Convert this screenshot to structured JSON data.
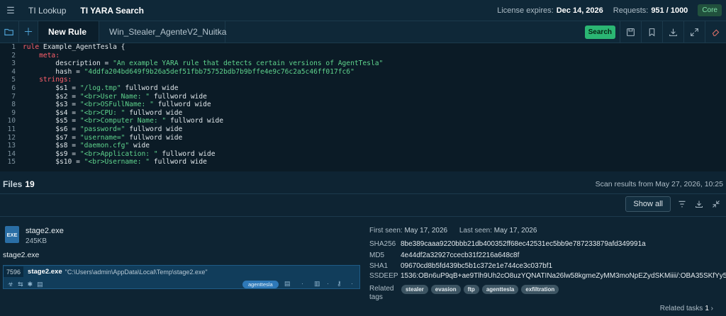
{
  "topbar": {
    "nav": [
      "TI Lookup",
      "TI YARA Search"
    ],
    "license_label": "License expires:",
    "license_value": "Dec 14, 2026",
    "requests_label": "Requests:",
    "requests_value": "951 / 1000",
    "plan": "Core"
  },
  "tabs": {
    "new_rule": "New Rule",
    "second": "Win_Stealer_AgenteV2_Nuitka",
    "search_button": "Search"
  },
  "editor": {
    "lines": [
      {
        "n": "1",
        "parts": [
          [
            "kw",
            "rule"
          ],
          [
            "key",
            " Example_AgentTesla {"
          ]
        ]
      },
      {
        "n": "2",
        "parts": [
          [
            "kw",
            "    meta:"
          ]
        ]
      },
      {
        "n": "3",
        "parts": [
          [
            "key",
            "        description = "
          ],
          [
            "str",
            "\"An example YARA rule that detects certain versions of AgentTesla\""
          ]
        ]
      },
      {
        "n": "4",
        "parts": [
          [
            "key",
            "        hash = "
          ],
          [
            "str",
            "\"4ddfa204bd649f9b26a5def51fbb75752bdb7b9bffe4e9c76c2a5c46ff017fc6\""
          ]
        ]
      },
      {
        "n": "5",
        "parts": [
          [
            "kw",
            "    strings:"
          ]
        ]
      },
      {
        "n": "6",
        "parts": [
          [
            "key",
            "        $s1 = "
          ],
          [
            "str",
            "\"/log.tmp\""
          ],
          [
            "key",
            " fullword wide"
          ]
        ]
      },
      {
        "n": "7",
        "parts": [
          [
            "key",
            "        $s2 = "
          ],
          [
            "str",
            "\"<br>User Name: \""
          ],
          [
            "key",
            " fullword wide"
          ]
        ]
      },
      {
        "n": "8",
        "parts": [
          [
            "key",
            "        $s3 = "
          ],
          [
            "str",
            "\"<br>OSFullName: \""
          ],
          [
            "key",
            " fullword wide"
          ]
        ]
      },
      {
        "n": "9",
        "parts": [
          [
            "key",
            "        $s4 = "
          ],
          [
            "str",
            "\"<br>CPU: \""
          ],
          [
            "key",
            " fullword wide"
          ]
        ]
      },
      {
        "n": "10",
        "parts": [
          [
            "key",
            "        $s5 = "
          ],
          [
            "str",
            "\"<br>Computer Name: \""
          ],
          [
            "key",
            " fullword wide"
          ]
        ]
      },
      {
        "n": "11",
        "parts": [
          [
            "key",
            "        $s6 = "
          ],
          [
            "str",
            "\"password=\""
          ],
          [
            "key",
            " fullword wide"
          ]
        ]
      },
      {
        "n": "12",
        "parts": [
          [
            "key",
            "        $s7 = "
          ],
          [
            "str",
            "\"username=\""
          ],
          [
            "key",
            " fullword wide"
          ]
        ]
      },
      {
        "n": "13",
        "parts": [
          [
            "key",
            "        $s8 = "
          ],
          [
            "str",
            "\"daemon.cfg\""
          ],
          [
            "key",
            " wide"
          ]
        ]
      },
      {
        "n": "14",
        "parts": [
          [
            "key",
            "        $s9 = "
          ],
          [
            "str",
            "\"<br>Application: \""
          ],
          [
            "key",
            " fullword wide"
          ]
        ]
      },
      {
        "n": "15",
        "parts": [
          [
            "key",
            "        $s10 = "
          ],
          [
            "str",
            "\"<br>Username: \""
          ],
          [
            "key",
            " fullword wide"
          ]
        ]
      }
    ]
  },
  "files": {
    "label": "Files",
    "count": "19",
    "scan_text": "Scan results from May 27, 2026, 10:25",
    "show_all": "Show all"
  },
  "file": {
    "icon_text": "EXE",
    "name": "stage2.exe",
    "size": "245KB",
    "name_below": "stage2.exe",
    "process": {
      "pid": "7596",
      "name": "stage2.exe",
      "cmd": "\"C:\\Users\\admin\\AppData\\Local\\Temp\\stage2.exe\"",
      "tag": "agenttesla"
    }
  },
  "details": {
    "first_seen_label": "First seen:",
    "first_seen": "May 17, 2026",
    "last_seen_label": "Last seen:",
    "last_seen": "May 17, 2026",
    "hashes": [
      {
        "k": "SHA256",
        "v": "8be389caaa9220bbb21db400352ff68ec42531ec5bb9e787233879afd349991a"
      },
      {
        "k": "MD5",
        "v": "4e44df2a32927ccecb31f2216a648c8f"
      },
      {
        "k": "SHA1",
        "v": "09670cd8b5fd439bc5b1c372e1e744ce3c037bf1"
      },
      {
        "k": "SSDEEP",
        "v": "1536:OBn6uP9qB+ae9Tlh9Uh2cO8uzYQNATINa26lw58kgmeZyMM3moNpEZydSKMiiii/:OBA35SKfYy5Th7tZij"
      }
    ],
    "related_label_1": "Related",
    "related_label_2": "tags",
    "tags": [
      "stealer",
      "evasion",
      "ftp",
      "agenttesla",
      "exfiltration"
    ],
    "related_tasks_label": "Related tasks",
    "related_tasks_count": "1"
  }
}
